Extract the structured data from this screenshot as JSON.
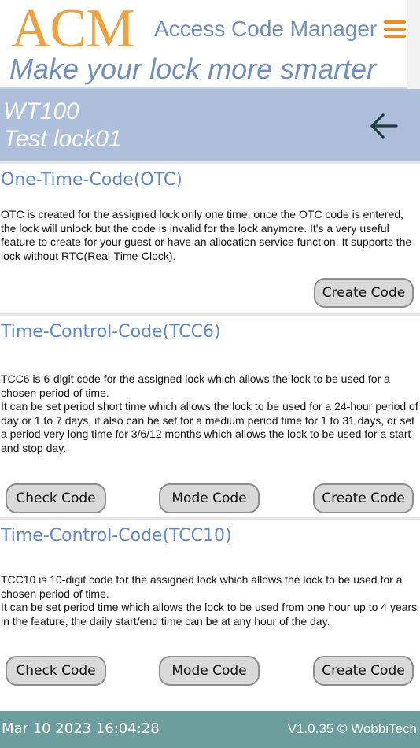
{
  "header": {
    "logo_text": "ACM",
    "app_name": "Access Code Manager",
    "tagline": "Make your lock more smarter",
    "menu_icon": "hamburger-menu-icon",
    "colors": {
      "logo": "#f0a13a",
      "text": "#6f8fc1",
      "menu": "#f08a1c"
    }
  },
  "lock": {
    "model": "WT100",
    "name": "Test lock01",
    "back_icon": "arrow-left-icon",
    "bar_color": "#aebfdb"
  },
  "otc": {
    "title": "One-Time-Code(OTC)",
    "description": "OTC is created for the assigned lock only one time, once the OTC code is entered, the lock will unlock but the code is invalid for the lock anymore. It's a very useful feature to create for your guest or have an allocation service function. It supports the lock without RTC(Real-Time-Clock).",
    "create_label": "Create Code"
  },
  "tcc6": {
    "title": "Time-Control-Code(TCC6)",
    "description_1": "TCC6 is 6-digit code for the assigned lock which allows the lock to be used for a chosen period of time.",
    "description_2": "It can be set period short time which allows the lock to be used for a 24-hour period of day or 1 to 7 days, it also can be set for a medium period time for 1 to 31 days, or set a period very long time for 3/6/12 months which allows the lock to be used for a start and stop day.",
    "check_label": "Check Code",
    "mode_label": "Mode Code",
    "create_label": "Create Code"
  },
  "tcc10": {
    "title": "Time-Control-Code(TCC10)",
    "description_1": "TCC10 is 10-digit code for the assigned lock which allows the lock to be used for a chosen period of time.",
    "description_2": "It can be set period time which allows the lock to be used from one hour up to 4 years in the feature, the daily start/end time can be at any hour of the day.",
    "check_label": "Check Code",
    "mode_label": "Mode Code",
    "create_label": "Create Code"
  },
  "footer": {
    "datetime": "Mar 10 2023 16:04:28",
    "version": "V1.0.35 © WobbiTech",
    "bar_color": "#6b9e9d"
  }
}
